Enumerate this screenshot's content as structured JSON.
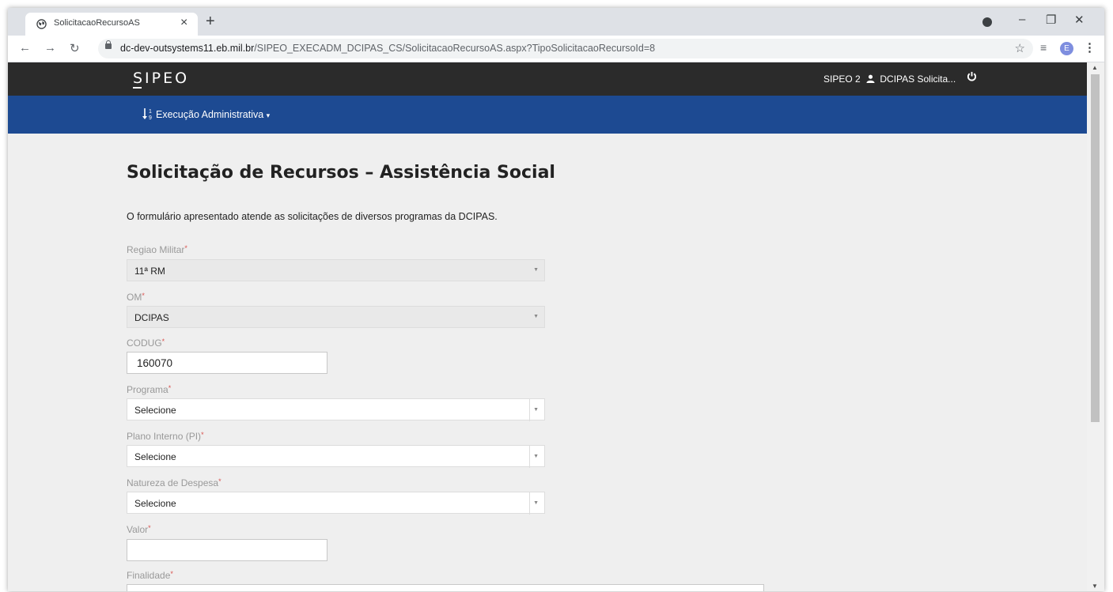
{
  "browser": {
    "tab_title": "SolicitacaoRecursoAS",
    "tab_close": "×",
    "new_tab": "+",
    "url_host": "dc-dev-outsystems11.eb.mil.br",
    "url_path": "/SIPEO_EXECADM_DCIPAS_CS/SolicitacaoRecursoAS.aspx?TipoSolicitacaoRecursoId=8",
    "profile_initial": "E"
  },
  "header": {
    "logo": "SIPEO",
    "system_link": "SIPEO 2",
    "user_name": "DCIPAS Solicita..."
  },
  "menu": {
    "execucao": "Execução Administrativa"
  },
  "form": {
    "title": "Solicitação de Recursos – Assistência Social",
    "intro": "O formulário apresentado atende as solicitações de diversos programas da DCIPAS.",
    "required_mark": "*",
    "regiao_label": "Regiao Militar",
    "regiao_value": "11ª RM",
    "om_label": "OM",
    "om_value": "DCIPAS",
    "codug_label": "CODUG",
    "codug_value": "160070",
    "programa_label": "Programa",
    "programa_value": "Selecione",
    "pi_label": "Plano Interno (PI)",
    "pi_value": "Selecione",
    "natureza_label": "Natureza de Despesa",
    "natureza_value": "Selecione",
    "valor_label": "Valor",
    "valor_value": "",
    "finalidade_label": "Finalidade"
  },
  "icons": {
    "user": "user-icon",
    "power": "power-icon",
    "sort": "sort-numeric-icon",
    "chevron": "chevron-down-icon"
  },
  "colors": {
    "header_bg": "#2b2b2b",
    "menu_bg": "#1d4a92",
    "required": "#d9534f"
  }
}
